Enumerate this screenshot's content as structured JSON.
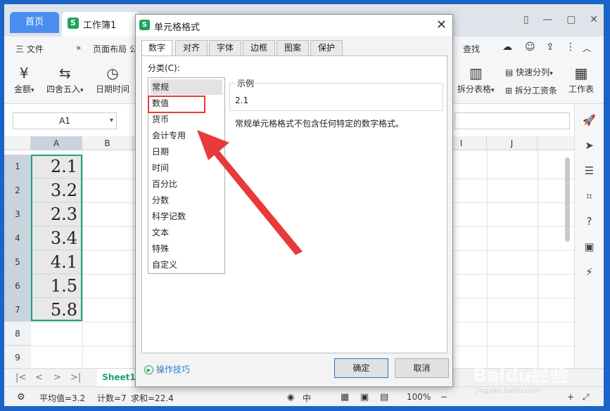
{
  "window": {
    "home_tab": "首页",
    "doc_tab": "工作簿1",
    "logo_letter": "S"
  },
  "menu": {
    "file": "三 文件",
    "more": "»",
    "layout": "页面布局 公",
    "search": "查找"
  },
  "ribbon": {
    "currency": "金额",
    "round": "四舍五入",
    "datetime": "日期时间",
    "split_table": "拆分表格",
    "quick_split": "快速分列",
    "split_payroll": "拆分工资条",
    "worksheet": "工作表"
  },
  "formula_bar": {
    "name_box": "A1"
  },
  "grid": {
    "columns": [
      "A",
      "B",
      "I",
      "J"
    ],
    "rows": [
      "1",
      "2",
      "3",
      "4",
      "5",
      "6",
      "7",
      "8",
      "9"
    ],
    "values": [
      "2.1",
      "3.2",
      "2.3",
      "3.4",
      "4.1",
      "1.5",
      "5.8"
    ]
  },
  "sheet": {
    "tab": "Sheet1"
  },
  "status": {
    "average": "平均值=3.2",
    "count": "计数=7",
    "sum": "求和=22.4",
    "zoom": "100%",
    "lang": "中"
  },
  "dialog": {
    "title": "单元格格式",
    "tabs": [
      "数字",
      "对齐",
      "字体",
      "边框",
      "图案",
      "保护"
    ],
    "category_label": "分类(C):",
    "categories": [
      "常规",
      "数值",
      "货币",
      "会计专用",
      "日期",
      "时间",
      "百分比",
      "分数",
      "科学记数",
      "文本",
      "特殊",
      "自定义"
    ],
    "sample_label": "示例",
    "sample_value": "2.1",
    "description": "常规单元格格式不包含任何特定的数字格式。",
    "tips": "操作技巧",
    "ok": "确定",
    "cancel": "取消"
  },
  "colors": {
    "accent_green": "#1ea36a",
    "highlight_red": "#e83a3a",
    "home_tab_blue": "#4a8ff0"
  },
  "watermark": {
    "brand": "Baidu经验",
    "sub": "jingyan.baidu.com"
  }
}
